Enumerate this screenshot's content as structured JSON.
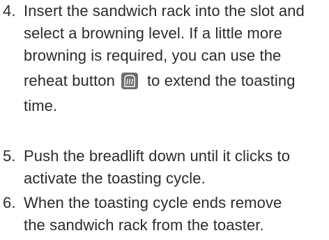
{
  "steps": [
    {
      "number": "4.",
      "lines": [
        "Insert the sandwich rack into the slot and",
        "select a browning level. If a little more",
        "browning is required, you can use the",
        "reheat button",
        "to extend the toasting",
        "time."
      ]
    },
    {
      "number": "5.",
      "lines": [
        "Push the breadlift down until it clicks to",
        "activate the toasting cycle."
      ]
    },
    {
      "number": "6.",
      "lines": [
        "When the toasting cycle ends remove",
        "the sandwich rack from the toaster."
      ]
    }
  ],
  "icons": {
    "reheat": "reheat-button-icon"
  },
  "colors": {
    "text": "#2b2b2b",
    "icon_fill": "#6e6e6e"
  }
}
